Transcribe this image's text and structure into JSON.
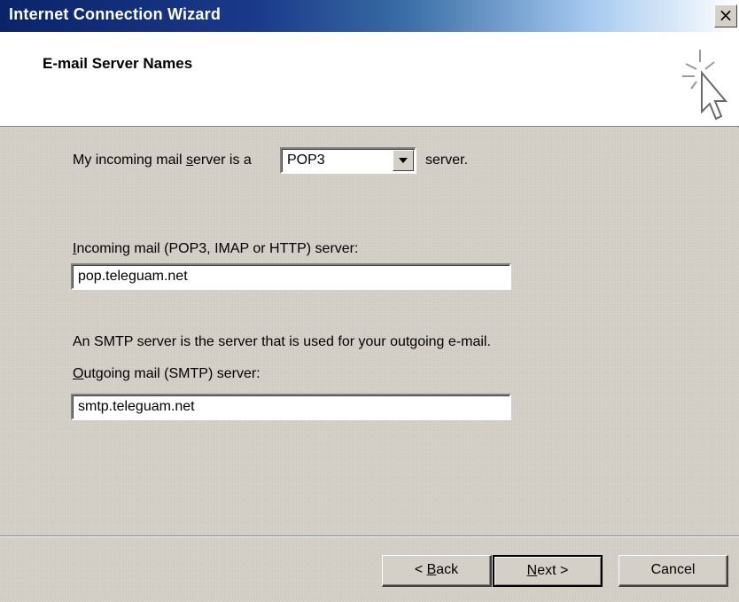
{
  "window": {
    "title": "Internet Connection Wizard",
    "close_label": "×"
  },
  "header": {
    "title": "E-mail Server Names",
    "icon": "wizard-cursor-icon"
  },
  "incoming_type": {
    "prefix": "My incoming mail ",
    "prefix_u": "s",
    "prefix_rest": "erver is a",
    "selected": "POP3",
    "suffix": "server."
  },
  "incoming_server": {
    "label_u": "I",
    "label_rest": "ncoming mail (POP3, IMAP or HTTP) server:",
    "value": "pop.teleguam.net"
  },
  "smtp_note": "An SMTP server is the server that is used for your outgoing e-mail.",
  "outgoing_server": {
    "label_u": "O",
    "label_rest": "utgoing mail (SMTP) server:",
    "value": "smtp.teleguam.net"
  },
  "buttons": {
    "back_prefix": "< ",
    "back_u": "B",
    "back_rest": "ack",
    "next_u": "N",
    "next_rest": "ext >",
    "cancel": "Cancel"
  },
  "colors": {
    "title_bar_start": "#0a246a",
    "dialog_face": "#d4d0c8",
    "header_bg": "#ffffff"
  }
}
